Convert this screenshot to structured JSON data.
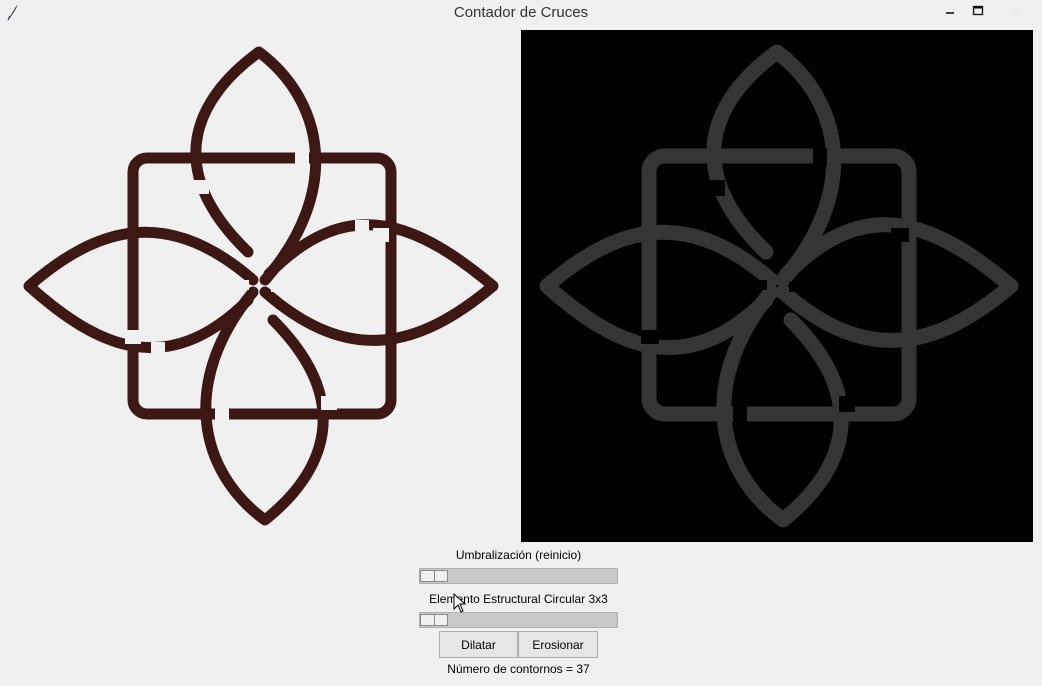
{
  "window": {
    "title": "Contador de Cruces",
    "minimize_label": "–",
    "maximize_label": "□",
    "close_label": "✕"
  },
  "colors": {
    "knot_original": "#3d1714",
    "knot_processed": "#353535",
    "canvas_processed_bg": "#000000"
  },
  "controls": {
    "threshold_label": "Umbralización (reinicio)",
    "threshold_value_fraction": 0,
    "structuring_label": "Elemento Estructural Circular 3x3",
    "structuring_value_fraction": 0,
    "dilate_label": "Dilatar",
    "erode_label": "Erosionar",
    "contours_text": "Número de contornos = 37"
  }
}
